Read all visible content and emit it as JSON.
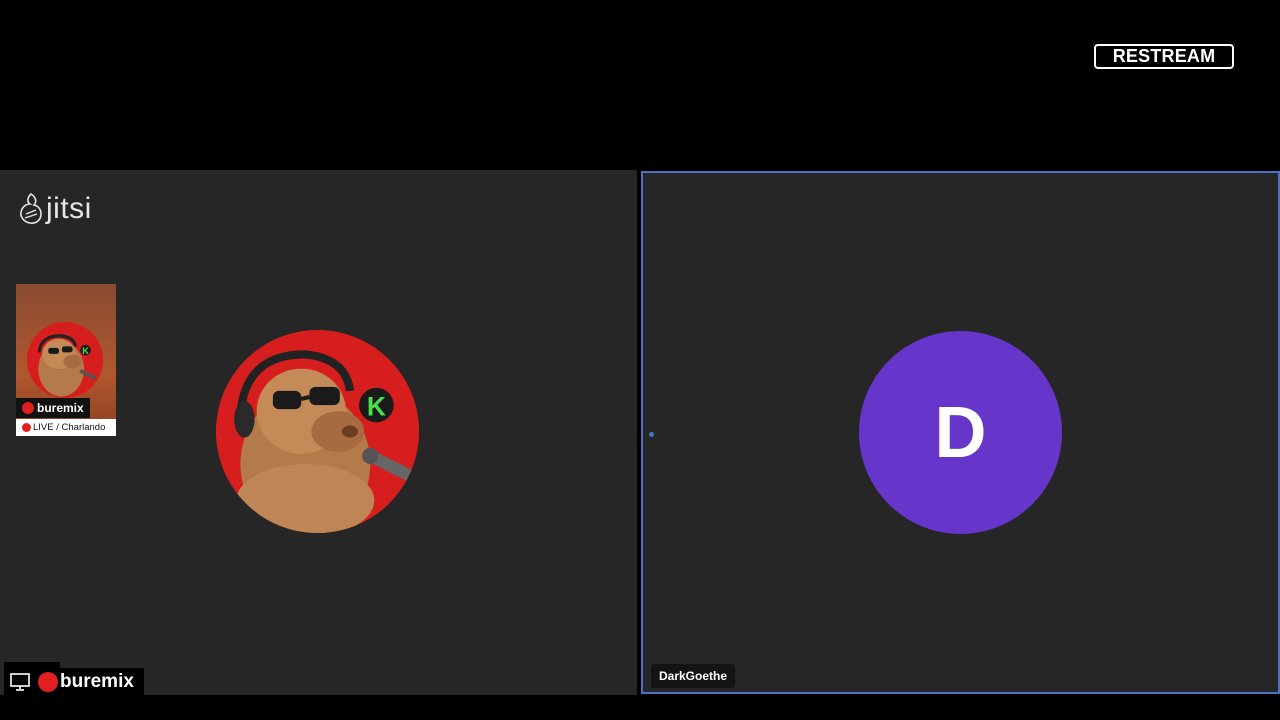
{
  "brand": {
    "restream_label": "RESTREAM",
    "jitsi_label": "jitsi"
  },
  "left_tile": {
    "thumbnail": {
      "name": "buremix",
      "live_text": "LIVE / Charlando",
      "avatar_icon": "alf-avatar-icon"
    },
    "main_avatar_icon": "alf-avatar-icon",
    "bottom_label": {
      "screen_icon": "monitor-icon",
      "name": "buremix"
    }
  },
  "right_tile": {
    "avatar_initial": "D",
    "avatar_color": "#6536c9",
    "display_name": "DarkGoethe",
    "active_border_color": "#4a72c4"
  }
}
